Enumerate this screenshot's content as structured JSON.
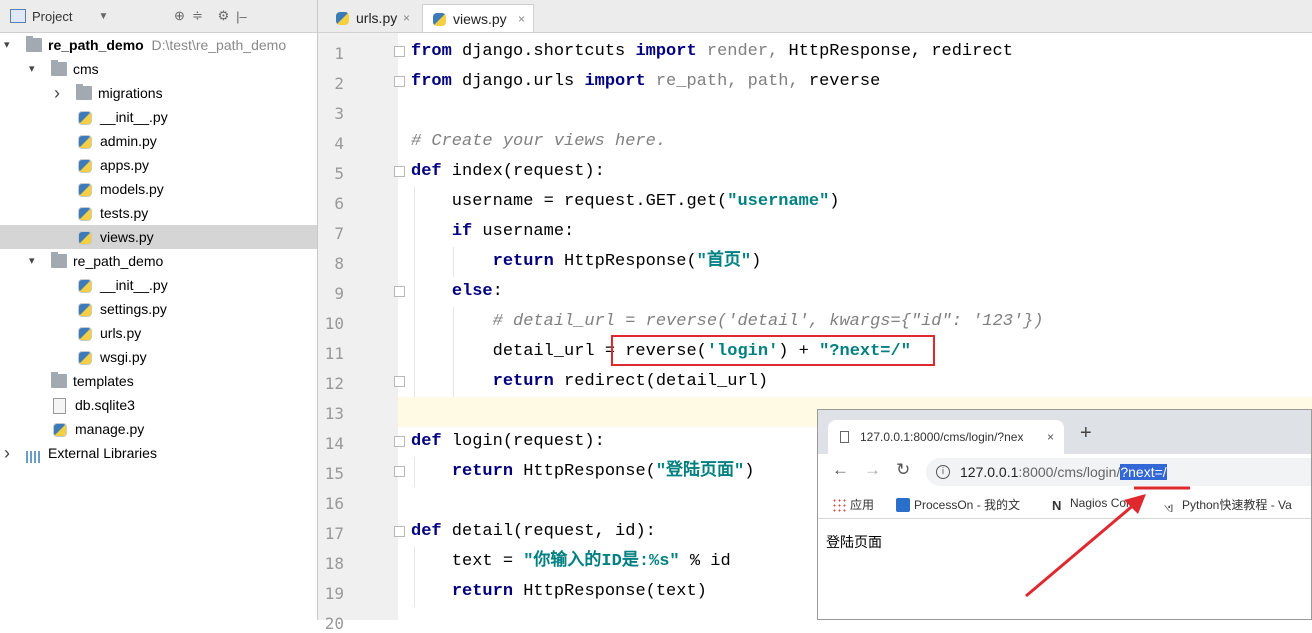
{
  "project_panel": {
    "title": "Project",
    "tools": [
      "⊕",
      "≑",
      "⚙",
      "|–"
    ],
    "tree": [
      {
        "label": "re_path_demo",
        "path": "D:\\test\\re_path_demo",
        "type": "folder",
        "expanded": true
      },
      {
        "label": "cms",
        "type": "folder",
        "expanded": true
      },
      {
        "label": "migrations",
        "type": "folder",
        "expanded": false
      },
      {
        "label": "__init__.py",
        "type": "py"
      },
      {
        "label": "admin.py",
        "type": "py"
      },
      {
        "label": "apps.py",
        "type": "py"
      },
      {
        "label": "models.py",
        "type": "py"
      },
      {
        "label": "tests.py",
        "type": "py"
      },
      {
        "label": "views.py",
        "type": "py",
        "selected": true
      },
      {
        "label": "re_path_demo",
        "type": "folder",
        "expanded": true
      },
      {
        "label": "__init__.py",
        "type": "py"
      },
      {
        "label": "settings.py",
        "type": "py"
      },
      {
        "label": "urls.py",
        "type": "py"
      },
      {
        "label": "wsgi.py",
        "type": "py"
      },
      {
        "label": "templates",
        "type": "folder"
      },
      {
        "label": "db.sqlite3",
        "type": "db"
      },
      {
        "label": "manage.py",
        "type": "py"
      },
      {
        "label": "External Libraries",
        "type": "lib",
        "expanded": false
      }
    ]
  },
  "editor": {
    "tabs": [
      {
        "label": "urls.py",
        "close": "×"
      },
      {
        "label": "views.py",
        "close": "×",
        "active": true
      }
    ],
    "line_numbers": [
      "1",
      "2",
      "3",
      "4",
      "5",
      "6",
      "7",
      "8",
      "9",
      "10",
      "11",
      "12",
      "13",
      "14",
      "15",
      "16",
      "17",
      "18",
      "19",
      "20"
    ]
  },
  "code": {
    "l1": {
      "kw1": "from",
      "mod": " django.shortcuts ",
      "kw2": "import",
      "dim": " render, ",
      "rest": "HttpResponse, redirect"
    },
    "l2": {
      "kw1": "from",
      "mod": " django.urls ",
      "kw2": "import",
      "dim": " re_path, path, ",
      "rest": "reverse"
    },
    "l4": {
      "comment": "# Create your views here."
    },
    "l5": {
      "kw": "def",
      "rest": " index(request):"
    },
    "l6": {
      "pre": "    username = request.GET.get(",
      "str": "\"username\"",
      "post": ")"
    },
    "l7": {
      "pre": "    ",
      "kw": "if",
      "rest": " username:"
    },
    "l8": {
      "pre": "        ",
      "kw": "return",
      "rest": " HttpResponse(",
      "str": "\"首页\"",
      "post": ")"
    },
    "l9": {
      "pre": "    ",
      "kw": "else",
      "rest": ":"
    },
    "l10": {
      "comment": "        # detail_url = reverse('detail', kwargs={\"id\": '123'})"
    },
    "l11": {
      "pre": "        detail_url = reverse(",
      "str1": "'login'",
      "mid": ") + ",
      "str2": "\"?next=/\""
    },
    "l12": {
      "pre": "        ",
      "kw": "return",
      "rest": " redirect(detail_url)"
    },
    "l14": {
      "kw": "def",
      "rest": " login(request):"
    },
    "l15": {
      "pre": "    ",
      "kw": "return",
      "rest": " HttpResponse(",
      "str": "\"登陆页面\"",
      "post": ")"
    },
    "l17": {
      "kw": "def",
      "rest": " detail(request, id):"
    },
    "l18": {
      "pre": "    text = ",
      "str": "\"你输入的ID是:%s\"",
      "post": " % id"
    },
    "l19": {
      "pre": "    ",
      "kw": "return",
      "rest": " HttpResponse(text)"
    }
  },
  "browser": {
    "tab_title": "127.0.0.1:8000/cms/login/?nex",
    "tab_close": "×",
    "new_tab": "+",
    "nav": {
      "back": "←",
      "forward": "→",
      "reload": "↻"
    },
    "url_host": "127.0.0.1",
    "url_path": ":8000/cms/login/",
    "url_query": "?next=/",
    "info_icon": "i",
    "bookmarks": [
      "应用",
      "ProcessOn - 我的文",
      "Nagios Core",
      "Python快速教程 - Va"
    ],
    "content_text": "登陆页面"
  },
  "colors": {
    "keyword": "#000080",
    "string": "#008080",
    "comment": "#808080",
    "highlight_box": "#e0292e",
    "selection": "#3367d6"
  }
}
